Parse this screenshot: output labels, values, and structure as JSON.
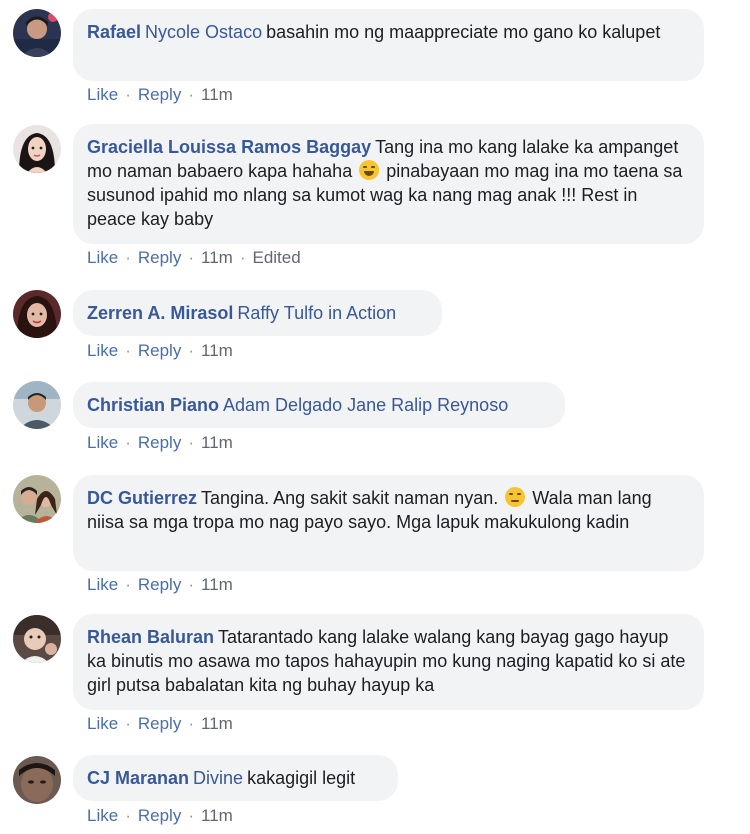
{
  "actions": {
    "like": "Like",
    "reply": "Reply",
    "dot": "·"
  },
  "comments": [
    {
      "author": "Rafael",
      "mention": "Nycole Ostaco",
      "text": "basahin mo ng maappreciate mo gano ko kalupet",
      "time": "11m"
    },
    {
      "author": "Graciella Louissa Ramos Baggay",
      "text_a": "Tang ina mo kang lalake ka ampanget mo naman babaero kapa hahaha",
      "text_b": "pinabayaan mo mag ina mo taena sa susunod ipahid mo nlang sa kumot wag ka nang mag anak !!! Rest in peace kay baby",
      "emoji": "laughing-crying-emoji",
      "time": "11m",
      "edited": "Edited"
    },
    {
      "author": "Zerren A. Mirasol",
      "mention": "Raffy Tulfo in Action",
      "time": "11m"
    },
    {
      "author": "Christian Piano",
      "mention": "Adam Delgado Jane Ralip Reynoso",
      "time": "11m"
    },
    {
      "author": "DC Gutierrez",
      "text_a": "Tangina. Ang sakit sakit naman nyan.",
      "text_b": "Wala man lang niisa sa mga tropa mo nag payo sayo. Mga lapuk makukulong kadin",
      "emoji": "sad-face-emoji",
      "time": "11m"
    },
    {
      "author": "Rhean Baluran",
      "text": "Tatarantado kang lalake walang kang bayag gago hayup ka binutis mo asawa mo tapos hahayupin mo kung naging kapatid ko si ate girl putsa babalatan kita ng buhay hayup ka",
      "time": "11m"
    },
    {
      "author": "CJ Maranan",
      "mention": "Divine",
      "text": "kakagigil legit",
      "time": "11m"
    }
  ],
  "colors": {
    "bubble": "#f2f3f5",
    "name_link": "#385898",
    "action_link": "#4a6ea8",
    "meta": "#606770"
  }
}
